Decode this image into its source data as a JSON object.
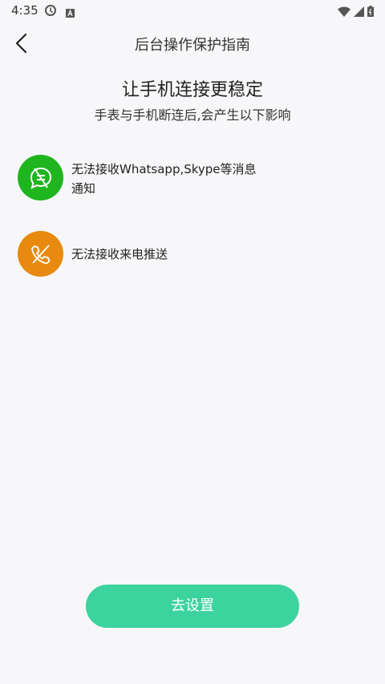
{
  "status_bar": {
    "time": "4:35",
    "icons": [
      "clock-notification-icon",
      "text-notification-icon",
      "wifi-icon",
      "signal-icon",
      "battery-icon"
    ]
  },
  "header": {
    "back_icon": "chevron-left-icon",
    "title": "后台操作保护指南"
  },
  "main": {
    "heading": "让手机连接更稳定",
    "subheading": "手表与手机断连后,会产生以下影响",
    "items": [
      {
        "icon": "message-off-icon",
        "color": "#1fb51f",
        "text": "无法接收Whatsapp,Skype等消息通知"
      },
      {
        "icon": "phone-off-icon",
        "color": "#e88a0f",
        "text": "无法接收来电推送"
      }
    ]
  },
  "action": {
    "button_label": "去设置",
    "button_color": "#3dd39f"
  }
}
